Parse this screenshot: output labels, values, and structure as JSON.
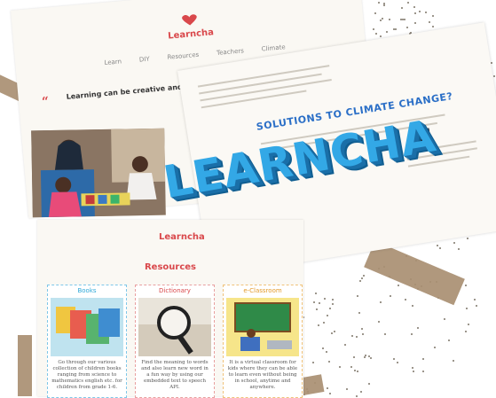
{
  "brand": {
    "logo_text": "Learncha",
    "logo_text_small": "Learncha"
  },
  "nav": {
    "items": [
      "Learn",
      "DIY",
      "Resources",
      "Teachers",
      "Climate"
    ]
  },
  "hero": {
    "quote_mark": "“",
    "tagline": "Learning can be creative and fun, with Learncha learning can become"
  },
  "article": {
    "title": "SOLUTIONS TO CLIMATE CHANGE?"
  },
  "resources": {
    "title": "Resources",
    "cards": [
      {
        "title": "Books",
        "desc": "Go through our various collection of children books ranging from science to mathematics english etc. for children from grade 1-6."
      },
      {
        "title": "Dictionary",
        "desc": "Find the meaning to words and also learn new word in a fun way by using our embedded text to speech API."
      },
      {
        "title": "e-Classroom",
        "desc": "It is a virtual classroom for kids where they can be able to learn even without being in school, anytime and anywhere."
      }
    ]
  },
  "big_title": "LEARNCHA",
  "colors": {
    "accent_red": "#d9484b",
    "accent_blue": "#2b6fc7",
    "title_blue": "#33a8e6"
  }
}
